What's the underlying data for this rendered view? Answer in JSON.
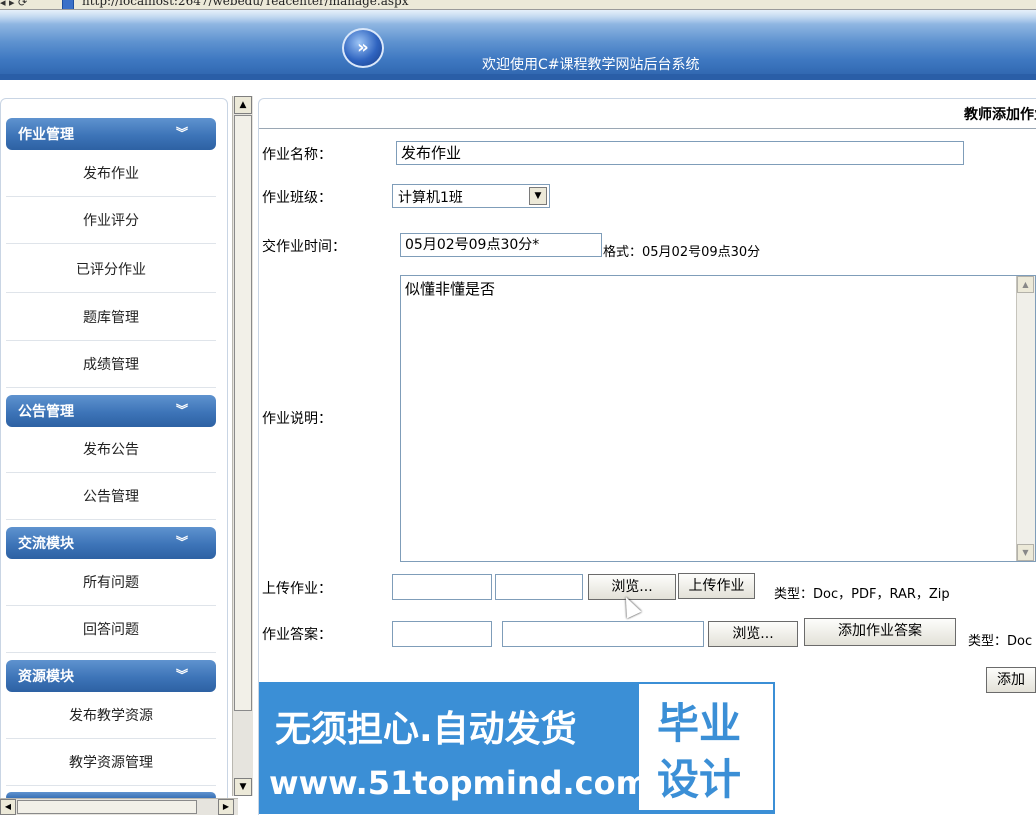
{
  "browser": {
    "url": "http://localhost:2647/webedu/Teacenter/manage.aspx"
  },
  "header": {
    "logo_symbol": "»",
    "title": "欢迎使用C#课程教学网站后台系统"
  },
  "sidebar": {
    "sections": [
      {
        "title": "作业管理",
        "items": [
          "发布作业",
          "作业评分",
          "已评分作业",
          "题库管理",
          "成绩管理"
        ]
      },
      {
        "title": "公告管理",
        "items": [
          "发布公告",
          "公告管理"
        ]
      },
      {
        "title": "交流模块",
        "items": [
          "所有问题",
          "回答问题"
        ]
      },
      {
        "title": "资源模块",
        "items": [
          "发布教学资源",
          "教学资源管理"
        ]
      }
    ],
    "chevron": "»"
  },
  "form": {
    "panel_title": "教师添加作业",
    "name_label": "作业名称：",
    "name_value": "发布作业",
    "class_label": "作业班级：",
    "class_value": "计算机1班",
    "time_label": "交作业时间：",
    "time_value": "05月02号09点30分*",
    "time_hint": "格式：05月02号09点30分",
    "desc_label": "作业说明：",
    "desc_value": "似懂非懂是否",
    "upload_label": "上传作业：",
    "browse_label": "浏览...",
    "upload_button": "上传作业",
    "upload_types": "类型：Doc，PDF，RAR，Zip",
    "answer_label": "作业答案：",
    "answer_browse_label": "浏览...",
    "answer_button": "添加作业答案",
    "answer_types": "类型：Doc",
    "submit_button": "添加"
  },
  "watermark": {
    "line1": "无须担心.自动发货",
    "line2": "www.51topmind.com",
    "box_line1": "毕业",
    "box_line2": "设计"
  },
  "colors": {
    "banner": "#3f79c2",
    "section_header": "#3d74b8",
    "watermark": "#3b8fd6"
  }
}
